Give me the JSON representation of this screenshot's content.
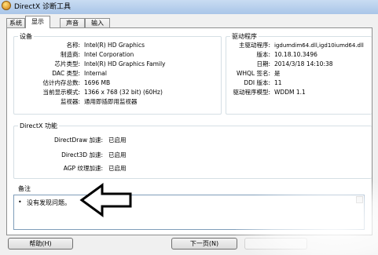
{
  "window": {
    "title": "DirectX 诊断工具"
  },
  "tabs": [
    {
      "label": "系统",
      "active": false
    },
    {
      "label": "显示",
      "active": true
    },
    {
      "label": "声音",
      "active": false
    },
    {
      "label": "输入",
      "active": false
    }
  ],
  "device": {
    "title": "设备",
    "rows": [
      {
        "label": "名称:",
        "value": "Intel(R) HD Graphics"
      },
      {
        "label": "制造商:",
        "value": "Intel Corporation"
      },
      {
        "label": "芯片类型:",
        "value": "Intel(R) HD Graphics Family"
      },
      {
        "label": "DAC 类型:",
        "value": "Internal"
      },
      {
        "label": "估计内存总数:",
        "value": "1696 MB"
      },
      {
        "label": "当前显示模式:",
        "value": "1366 x 768 (32 bit) (60Hz)"
      },
      {
        "label": "监视器:",
        "value": "通用即插即用监视器"
      }
    ]
  },
  "driver": {
    "title": "驱动程序",
    "rows": [
      {
        "label": "主驱动程序:",
        "value": "igdumdim64.dll,igd10iumd64.dll"
      },
      {
        "label": "版本:",
        "value": "10.18.10.3496"
      },
      {
        "label": "日期:",
        "value": "2014/3/18 14:10:38"
      },
      {
        "label": "WHQL 签名:",
        "value": "是"
      },
      {
        "label": "DDI 版本:",
        "value": "11"
      },
      {
        "label": "驱动程序模型:",
        "value": "WDDM 1.1"
      }
    ]
  },
  "directx": {
    "title": "DirectX 功能",
    "rows": [
      {
        "label": "DirectDraw 加速:",
        "value": "已启用"
      },
      {
        "label": "Direct3D 加速:",
        "value": "已启用"
      },
      {
        "label": "AGP 纹理加速:",
        "value": "已启用"
      }
    ]
  },
  "notes": {
    "title": "备注",
    "items": [
      "没有发现问题。"
    ]
  },
  "buttons": {
    "help": "帮助(H)",
    "next": "下一页(N)"
  },
  "colors": {
    "titlebar": "#b5cfee",
    "panel_border": "#8e8f8f",
    "group_border": "#d5dfe5"
  }
}
